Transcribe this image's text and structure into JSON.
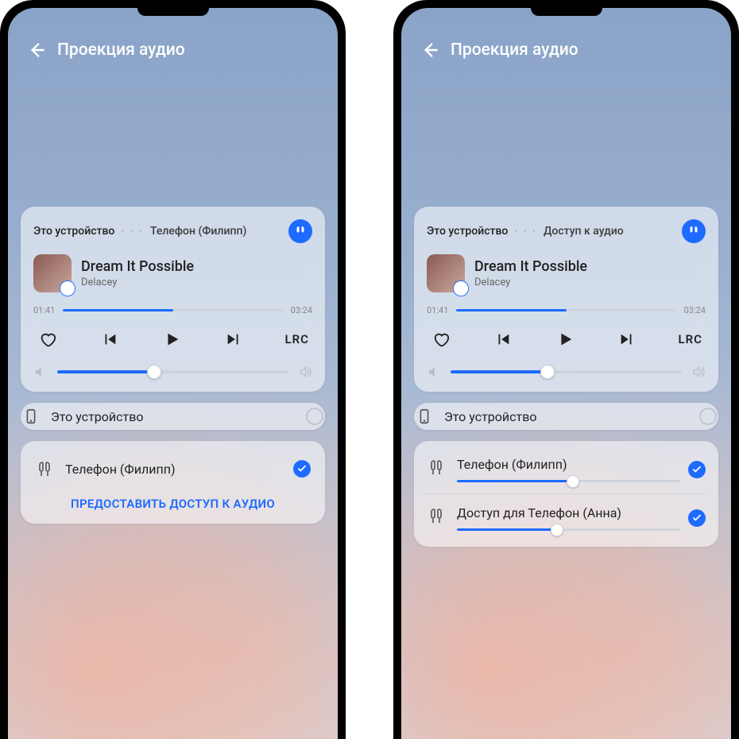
{
  "header": {
    "title": "Проекция аудио"
  },
  "player": {
    "tab_this": "Это устройство",
    "tab_second_left": "Телефон (Филипп)",
    "tab_second_right": "Доступ к аудио",
    "track_title": "Dream It Possible",
    "track_artist": "Delacey",
    "time_current": "01:41",
    "time_total": "03:24",
    "lrc_label": "LRC",
    "progress_pct": 50,
    "volume_pct": 42
  },
  "devices": {
    "this_device": "Это устройство",
    "phone_philipp": "Телефон (Филипп)",
    "share_action": "ПРЕДОСТАВИТЬ ДОСТУП К АУДИО"
  },
  "shared": {
    "phone_philipp": "Телефон (Филипп)",
    "phone_anna": "Доступ для Телефон (Анна)",
    "vol_philipp": 52,
    "vol_anna": 45
  },
  "colors": {
    "accent": "#1d6bff"
  }
}
